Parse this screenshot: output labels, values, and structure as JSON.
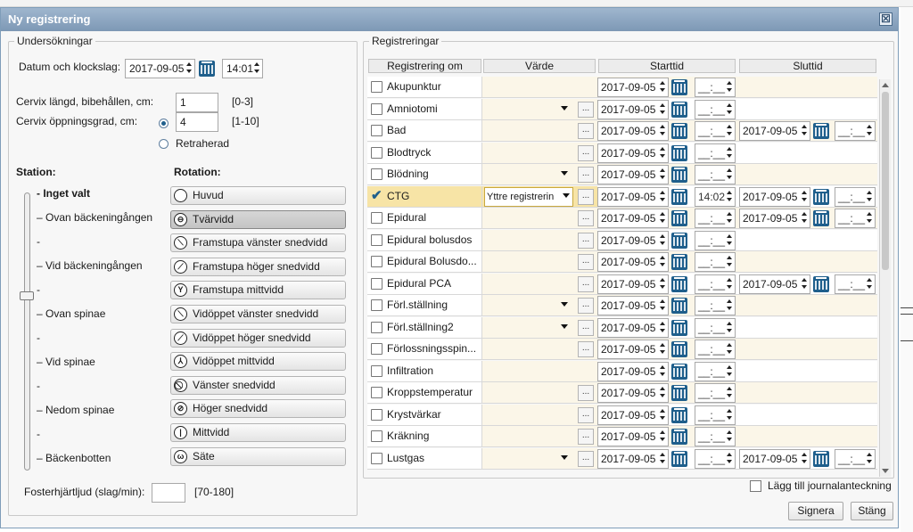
{
  "dialog": {
    "title": "Ny registrering",
    "close_symbol": "☒"
  },
  "left": {
    "legend": "Undersökningar",
    "date_label": "Datum och klockslag:",
    "date_value": "2017-09-05",
    "time_value": "14:01",
    "cervix_length_label": "Cervix längd, bibehållen, cm:",
    "cervix_length_value": "1",
    "cervix_length_range": "[0-3]",
    "cervix_open_label": "Cervix öppningsgrad, cm:",
    "cervix_open_value": "4",
    "cervix_open_range": "[1-10]",
    "retraherad_label": "Retraherad",
    "station_heading": "Station:",
    "rotation_heading": "Rotation:",
    "stations": [
      "- Inget valt",
      "– Ovan bäckeningången",
      "-",
      "– Vid bäckeningången",
      "-",
      "– Ovan spinae",
      "-",
      "– Vid spinae",
      "-",
      "– Nedom spinae",
      "-",
      "– Bäckenbotten"
    ],
    "rotations": [
      {
        "label": "Huvud",
        "icon": "circle-icon",
        "glyph": ""
      },
      {
        "label": "Tvärvidd",
        "icon": "horizontal-line-icon",
        "glyph": "⊖"
      },
      {
        "label": "Framstupa vänster snedvidd",
        "icon": "fetal-left-oblique-icon",
        "glyph": "⟍"
      },
      {
        "label": "Framstupa höger snedvidd",
        "icon": "fetal-right-oblique-icon",
        "glyph": "⟋"
      },
      {
        "label": "Framstupa mittvidd",
        "icon": "fetal-y-icon",
        "glyph": "Y"
      },
      {
        "label": "Vidöppet vänster snedvidd",
        "icon": "open-left-oblique-icon",
        "glyph": "⟍"
      },
      {
        "label": "Vidöppet höger snedvidd",
        "icon": "open-right-oblique-icon",
        "glyph": "⟋"
      },
      {
        "label": "Vidöppet mittvidd",
        "icon": "open-lambda-icon",
        "glyph": "⅄"
      },
      {
        "label": "Vänster snedvidd",
        "icon": "left-oblique-icon",
        "glyph": "⃠"
      },
      {
        "label": "Höger snedvidd",
        "icon": "right-oblique-icon",
        "glyph": "⊘"
      },
      {
        "label": "Mittvidd",
        "icon": "vertical-line-icon",
        "glyph": "|"
      },
      {
        "label": "Säte",
        "icon": "breech-icon",
        "glyph": "ω"
      }
    ],
    "fhr_label": "Fosterhjärtljud (slag/min):",
    "fhr_value": "",
    "fhr_range": "[70-180]"
  },
  "registrations": {
    "legend": "Registreringar",
    "headers": {
      "name": "Registrering om",
      "value": "Värde",
      "start": "Starttid",
      "end": "Sluttid"
    },
    "time_placeholder": "__:__",
    "rows": [
      {
        "name": "Akupunktur",
        "checked": false,
        "value": "",
        "dropdown": false,
        "ellipsis": false,
        "start_date": "2017-09-05",
        "start_time": "__:__",
        "end_date": "",
        "end_time": ""
      },
      {
        "name": "Amniotomi",
        "checked": false,
        "value": "",
        "dropdown": true,
        "ellipsis": true,
        "start_date": "2017-09-05",
        "start_time": "__:__",
        "end_date": "",
        "end_time": ""
      },
      {
        "name": "Bad",
        "checked": false,
        "value": "",
        "dropdown": false,
        "ellipsis": true,
        "start_date": "2017-09-05",
        "start_time": "__:__",
        "end_date": "2017-09-05",
        "end_time": "__:__"
      },
      {
        "name": "Blodtryck",
        "checked": false,
        "value": "",
        "dropdown": false,
        "ellipsis": true,
        "start_date": "2017-09-05",
        "start_time": "__:__",
        "end_date": "",
        "end_time": ""
      },
      {
        "name": "Blödning",
        "checked": false,
        "value": "",
        "dropdown": true,
        "ellipsis": true,
        "start_date": "2017-09-05",
        "start_time": "__:__",
        "end_date": "",
        "end_time": ""
      },
      {
        "name": "CTG",
        "checked": true,
        "value": "Yttre registrerin",
        "dropdown": true,
        "ellipsis": true,
        "start_date": "2017-09-05",
        "start_time": "14:02",
        "end_date": "2017-09-05",
        "end_time": "__:__"
      },
      {
        "name": "Epidural",
        "checked": false,
        "value": "",
        "dropdown": false,
        "ellipsis": true,
        "start_date": "2017-09-05",
        "start_time": "__:__",
        "end_date": "2017-09-05",
        "end_time": "__:__"
      },
      {
        "name": "Epidural bolusdos",
        "checked": false,
        "value": "",
        "dropdown": false,
        "ellipsis": true,
        "start_date": "2017-09-05",
        "start_time": "__:__",
        "end_date": "",
        "end_time": ""
      },
      {
        "name": "Epidural Bolusdo...",
        "checked": false,
        "value": "",
        "dropdown": false,
        "ellipsis": true,
        "start_date": "2017-09-05",
        "start_time": "__:__",
        "end_date": "",
        "end_time": ""
      },
      {
        "name": "Epidural PCA",
        "checked": false,
        "value": "",
        "dropdown": false,
        "ellipsis": true,
        "start_date": "2017-09-05",
        "start_time": "__:__",
        "end_date": "2017-09-05",
        "end_time": "__:__"
      },
      {
        "name": "Förl.ställning",
        "checked": false,
        "value": "",
        "dropdown": true,
        "ellipsis": true,
        "start_date": "2017-09-05",
        "start_time": "__:__",
        "end_date": "",
        "end_time": ""
      },
      {
        "name": "Förl.ställning2",
        "checked": false,
        "value": "",
        "dropdown": true,
        "ellipsis": true,
        "start_date": "2017-09-05",
        "start_time": "__:__",
        "end_date": "",
        "end_time": ""
      },
      {
        "name": "Förlossningsspin...",
        "checked": false,
        "value": "",
        "dropdown": false,
        "ellipsis": true,
        "start_date": "2017-09-05",
        "start_time": "__:__",
        "end_date": "",
        "end_time": ""
      },
      {
        "name": "Infiltration",
        "checked": false,
        "value": "",
        "dropdown": false,
        "ellipsis": false,
        "start_date": "2017-09-05",
        "start_time": "__:__",
        "end_date": "",
        "end_time": ""
      },
      {
        "name": "Kroppstemperatur",
        "checked": false,
        "value": "",
        "dropdown": false,
        "ellipsis": true,
        "start_date": "2017-09-05",
        "start_time": "__:__",
        "end_date": "",
        "end_time": ""
      },
      {
        "name": "Krystvärkar",
        "checked": false,
        "value": "",
        "dropdown": false,
        "ellipsis": true,
        "start_date": "2017-09-05",
        "start_time": "__:__",
        "end_date": "",
        "end_time": ""
      },
      {
        "name": "Kräkning",
        "checked": false,
        "value": "",
        "dropdown": false,
        "ellipsis": true,
        "start_date": "2017-09-05",
        "start_time": "__:__",
        "end_date": "",
        "end_time": ""
      },
      {
        "name": "Lustgas",
        "checked": false,
        "value": "",
        "dropdown": true,
        "ellipsis": true,
        "start_date": "2017-09-05",
        "start_time": "__:__",
        "end_date": "2017-09-05",
        "end_time": "__:__"
      }
    ]
  },
  "footer": {
    "journal_label": "Lägg till journalanteckning",
    "sign_label": "Signera",
    "close_label": "Stäng"
  },
  "colors": {
    "row_alt": "#fbf6e8",
    "row_selected": "#f7e4a6",
    "title_bar": "#8aa4bf",
    "accent": "#1f5f8c"
  }
}
